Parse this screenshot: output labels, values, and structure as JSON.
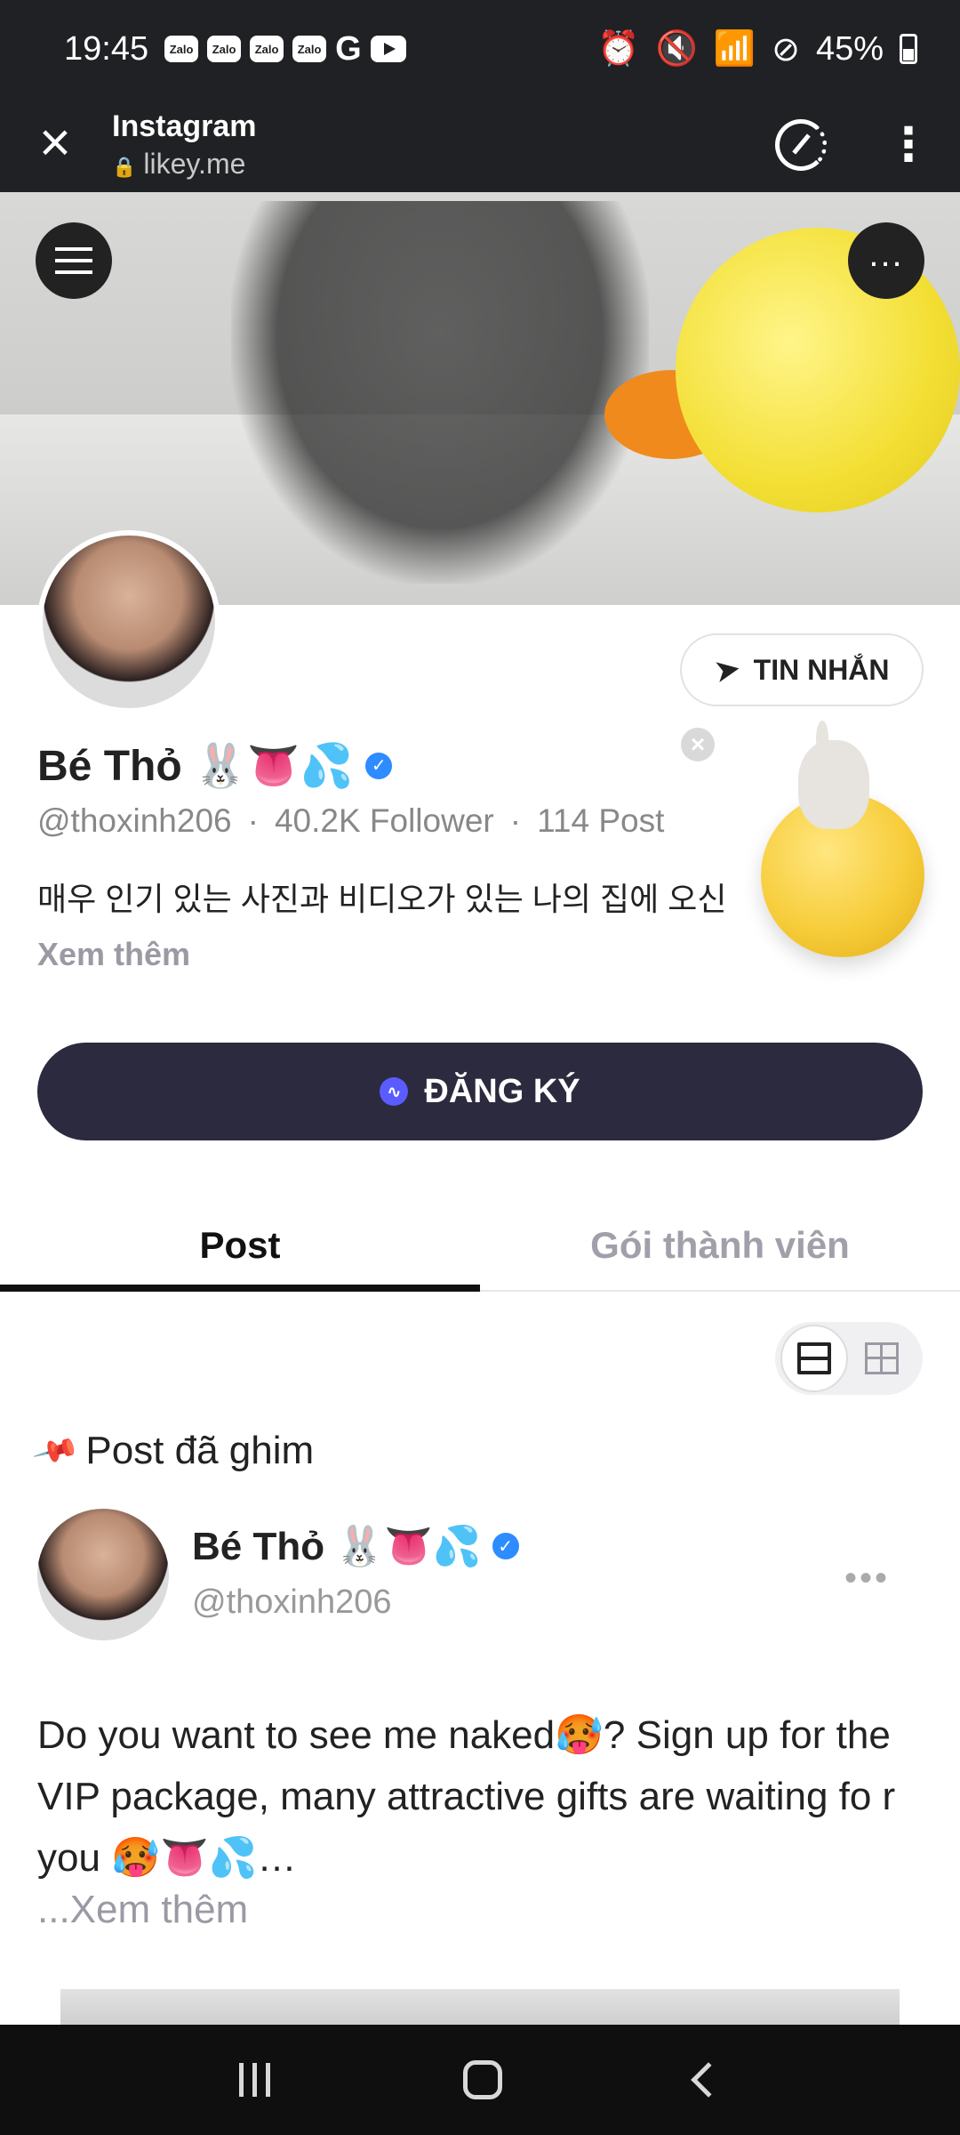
{
  "status_bar": {
    "time": "19:45",
    "apps": [
      "Zalo",
      "Zalo",
      "Zalo",
      "Zalo",
      "G"
    ],
    "battery": "45%"
  },
  "browser": {
    "title": "Instagram",
    "domain": "likey.me"
  },
  "profile": {
    "name": "Bé Thỏ 🐰👅💦",
    "handle": "@thoxinh206",
    "followers": "40.2K Follower",
    "posts": "114 Post",
    "bio": "매우 인기 있는 사진과 비디오가 있는 나의 집에 오신",
    "see_more": "Xem thêm",
    "message_label": "TIN NHẮN",
    "subscribe_label": "ĐĂNG KÝ"
  },
  "tabs": [
    {
      "label": "Post",
      "active": true
    },
    {
      "label": "Gói thành viên",
      "active": false
    }
  ],
  "pinned": {
    "label": "Post đã ghim"
  },
  "post": {
    "author": "Bé Thỏ 🐰👅💦",
    "handle": "@thoxinh206",
    "text": "Do you want to see me naked🥵? Sign up for the VIP package, many attractive gifts are waiting fo r you 🥵👅💦…",
    "see_more": "...Xem thêm"
  }
}
